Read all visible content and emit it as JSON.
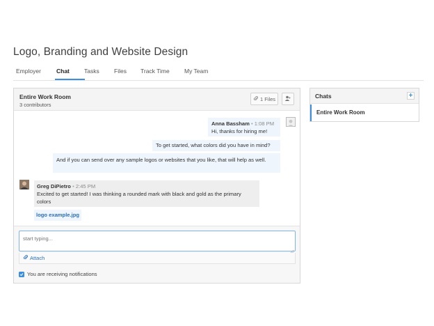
{
  "page": {
    "title": "Logo, Branding and Website Design"
  },
  "tabs": [
    {
      "label": "Employer"
    },
    {
      "label": "Chat"
    },
    {
      "label": "Tasks"
    },
    {
      "label": "Files"
    },
    {
      "label": "Track Time"
    },
    {
      "label": "My Team"
    }
  ],
  "active_tab": "Chat",
  "room": {
    "title": "Entire Work Room",
    "subtitle": "3 contributors",
    "files_label": "1 Files"
  },
  "messages": [
    {
      "sender": "Anna Bassham",
      "time": "1:08 PM",
      "separator": "•",
      "lines": [
        "Hi, thanks for hiring me!",
        "To get started, what colors did you have in mind?",
        "And if you can send over any sample logos or websites that you like, that will help as well."
      ]
    },
    {
      "sender": "Greg DiPietro",
      "time": "2:45 PM",
      "separator": "•",
      "text": "Excited to get started!  I was thinking a rounded mark with black and gold as the primary colors",
      "attachment": "logo example.jpg"
    }
  ],
  "composer": {
    "placeholder": "start typing...",
    "attach_label": "Attach",
    "notifications_label": "You are receiving notifications"
  },
  "chats": {
    "title": "Chats",
    "add_symbol": "+",
    "items": [
      {
        "label": "Entire Work Room"
      }
    ]
  },
  "colors": {
    "accent": "#3d8ee0",
    "bubble_blue": "#eef5fd",
    "bubble_gray": "#eeeeee"
  },
  "icons": [
    "paperclip-icon",
    "people-icon",
    "avatar-placeholder-icon",
    "checkbox-checked-icon",
    "plus-icon"
  ]
}
